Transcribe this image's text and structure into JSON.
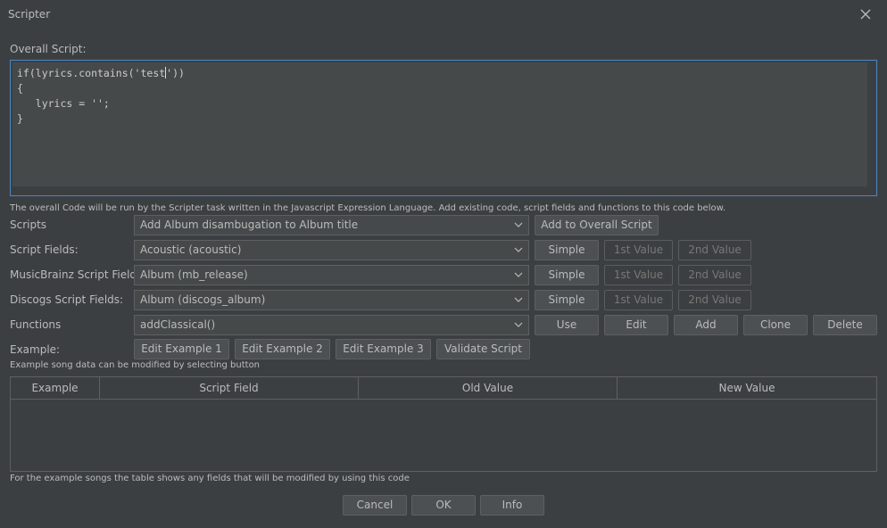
{
  "window": {
    "title": "Scripter",
    "close_icon": "close-icon"
  },
  "overall_script": {
    "label": "Overall Script:",
    "code_lines": [
      "if(lyrics.contains('test",
      "'))",
      "{",
      "   lyrics = '';",
      "}"
    ],
    "help": "The overall Code will be run by the Scripter task written in the Javascript Expression Language. Add existing code, script fields and functions to this code below."
  },
  "scripts": {
    "label": "Scripts",
    "selected": "Add Album disambugation to Album title",
    "add_button": "Add to Overall Script"
  },
  "script_fields": {
    "label": "Script Fields:",
    "selected": "Acoustic (acoustic)",
    "simple": "Simple",
    "first": "1st Value",
    "second": "2nd Value"
  },
  "musicbrainz_fields": {
    "label": "MusicBrainz Script Fields:",
    "selected": "Album (mb_release)",
    "simple": "Simple",
    "first": "1st Value",
    "second": "2nd Value"
  },
  "discogs_fields": {
    "label": "Discogs Script Fields:",
    "selected": "Album (discogs_album)",
    "simple": "Simple",
    "first": "1st Value",
    "second": "2nd Value"
  },
  "functions": {
    "label": "Functions",
    "selected": "addClassical()",
    "use": "Use",
    "edit": "Edit",
    "add": "Add",
    "clone": "Clone",
    "delete": "Delete"
  },
  "example": {
    "label": "Example:",
    "edit1": "Edit Example 1",
    "edit2": "Edit Example 2",
    "edit3": "Edit Example 3",
    "validate": "Validate Script",
    "help": "Example song data can be modified by selecting button"
  },
  "table": {
    "columns": [
      "Example",
      "Script Field",
      "Old Value",
      "New Value"
    ],
    "help": "For the example songs the table shows any fields that will be modified by using this code"
  },
  "footer": {
    "cancel": "Cancel",
    "ok": "OK",
    "info": "Info"
  }
}
